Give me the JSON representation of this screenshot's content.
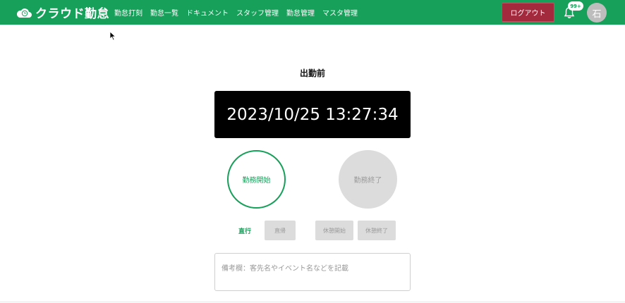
{
  "header": {
    "brand": "クラウド勤怠",
    "nav_links": [
      "勤怠打刻",
      "勤怠一覧",
      "ドキュメント",
      "スタッフ管理",
      "勤怠管理",
      "マスタ管理"
    ],
    "logout_label": "ログアウト",
    "notification_count": "99+",
    "avatar_initial": "石",
    "icons": [
      "cloud-clock-logo-icon",
      "bell-icon"
    ],
    "colors": {
      "nav_bg": "#17a05a",
      "logout_bg": "#a3293d"
    }
  },
  "punch": {
    "status": "出勤前",
    "clock": "2023/10/25 13:27:34",
    "start_label": "勤務開始",
    "end_label": "勤務終了",
    "direct_go_label": "直行",
    "direct_return_label": "直帰",
    "break_start_label": "休憩開始",
    "break_end_label": "休憩終了",
    "note_placeholder": "備考欄：客先名やイベント名などを記載",
    "note_value": ""
  }
}
